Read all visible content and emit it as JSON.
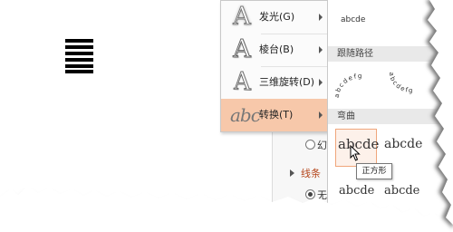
{
  "effects_menu": {
    "items": [
      {
        "label": "发光(G)",
        "icon": "glow-icon"
      },
      {
        "label": "棱台(B)",
        "icon": "bevel-icon"
      },
      {
        "label": "三维旋转(D)",
        "icon": "3d-rotation-icon"
      },
      {
        "label": "转换(T)",
        "icon": "transform-icon",
        "active": true
      }
    ]
  },
  "gallery": {
    "top_sample": "abcde",
    "path_section": "跟随路径",
    "path_samples": [
      "abcdefg",
      "abcdefg"
    ],
    "warp_section": "弯曲",
    "warp_samples": [
      "abcde",
      "abcde",
      "abcde",
      "abcde"
    ],
    "tooltip": "正方形"
  },
  "format_panel": {
    "option_fragment": "幻",
    "section_label": "线条",
    "radio_fragment": "无"
  },
  "colors": {
    "menu_active": "#f7c8aa",
    "section_header_bg": "#e9e9e9",
    "selected_cell_border": "#f0a67b",
    "panel_heading": "#b5471d"
  }
}
